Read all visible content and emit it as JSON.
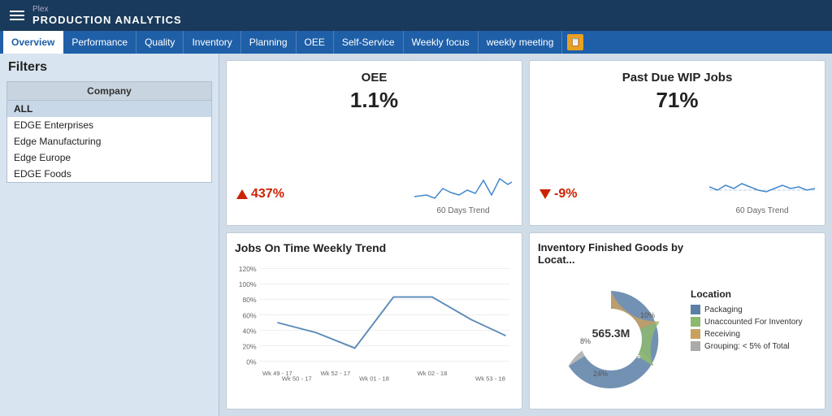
{
  "header": {
    "plex_label": "Plex",
    "app_title": "PRODUCTION ANALYTICS",
    "menu_icon": "menu"
  },
  "nav": {
    "tabs": [
      {
        "label": "Overview",
        "active": true
      },
      {
        "label": "Performance",
        "active": false
      },
      {
        "label": "Quality",
        "active": false
      },
      {
        "label": "Inventory",
        "active": false
      },
      {
        "label": "Planning",
        "active": false
      },
      {
        "label": "OEE",
        "active": false
      },
      {
        "label": "Self-Service",
        "active": false
      },
      {
        "label": "Weekly focus",
        "active": false
      },
      {
        "label": "weekly meeting",
        "active": false
      }
    ]
  },
  "sidebar": {
    "filters_title": "Filters",
    "company_header": "Company",
    "companies": [
      {
        "label": "ALL",
        "selected": true
      },
      {
        "label": "EDGE Enterprises",
        "selected": false
      },
      {
        "label": "Edge Manufacturing",
        "selected": false
      },
      {
        "label": "Edge Europe",
        "selected": false
      },
      {
        "label": "EDGE Foods",
        "selected": false
      }
    ]
  },
  "oee_card": {
    "title": "OEE",
    "value": "1.1%",
    "trend_value": "437%",
    "trend_direction": "up",
    "trend_label": "60 Days Trend"
  },
  "wip_card": {
    "title": "Past Due WIP Jobs",
    "value": "71%",
    "trend_value": "-9%",
    "trend_direction": "down",
    "trend_label": "60 Days Trend"
  },
  "jobs_card": {
    "title": "Jobs On Time Weekly Trend",
    "y_labels": [
      "120%",
      "100%",
      "80%",
      "60%",
      "40%",
      "20%",
      "0%"
    ],
    "x_labels": [
      "Wk 49 - 17",
      "Wk 50 - 17",
      "Wk 52 - 17",
      "Wk 01 - 18",
      "Wk 02 - 18",
      "Wk 53 - 18"
    ]
  },
  "inventory_card": {
    "title": "Inventory Finished Goods by Locat...",
    "center_value": "565.3M",
    "segments": [
      {
        "label": "Packaging",
        "color": "#5b7fa6",
        "percent": 59,
        "pct_label": "59%"
      },
      {
        "label": "Unaccounted For Inventory",
        "color": "#8db870",
        "percent": 8,
        "pct_label": "8%"
      },
      {
        "label": "Receiving",
        "color": "#c8a060",
        "percent": 10,
        "pct_label": "10%"
      },
      {
        "label": "Grouping: < 5% of Total",
        "color": "#aaaaaa",
        "percent": 24,
        "pct_label": "24%"
      }
    ],
    "legend_title": "Location"
  }
}
